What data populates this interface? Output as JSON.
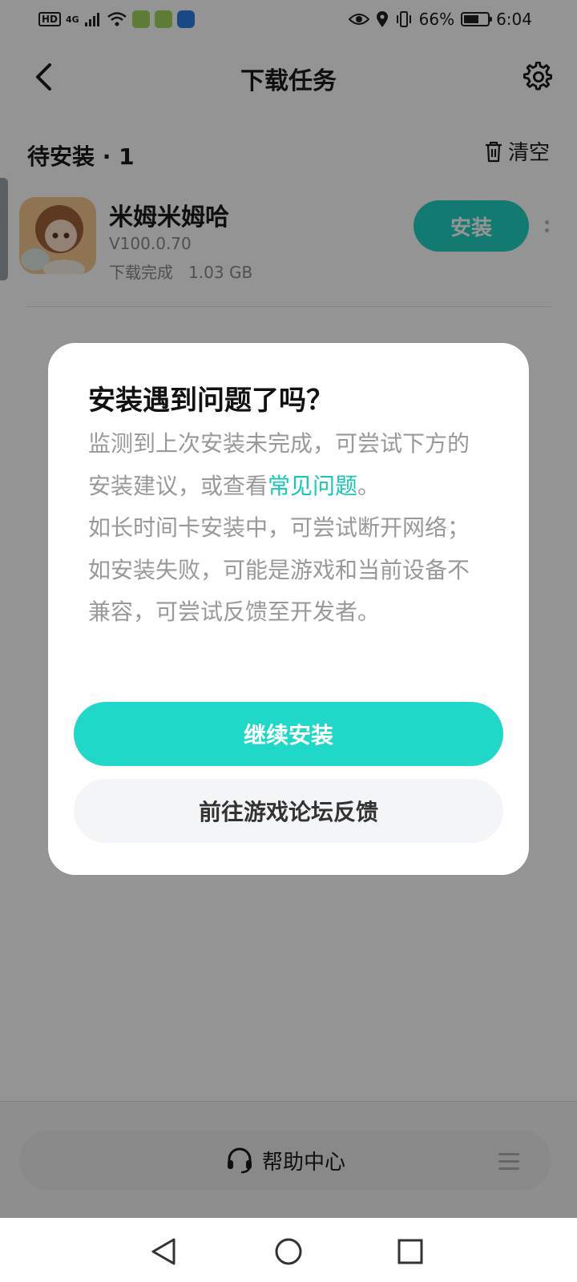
{
  "status_bar": {
    "hd": "HD",
    "network": "4G",
    "battery": "66%",
    "battery_level": 0.66,
    "time": "6:04"
  },
  "header": {
    "title": "下载任务",
    "back_icon": "chevron-left-icon",
    "settings_icon": "gear-icon"
  },
  "section": {
    "title": "待安装 · 1",
    "clear_label": "清空",
    "clear_icon": "trash-icon"
  },
  "app": {
    "name": "米姆米姆哈",
    "version": "V100.0.70",
    "status": "下载完成   1.03 GB",
    "install_label": "安装"
  },
  "bottom": {
    "help_label": "帮助中心",
    "help_icon": "headset-icon"
  },
  "dialog": {
    "title": "安装遇到问题了吗？",
    "body_line1_pre": "监测到上次安装未完成，可尝试下方的安装建议，或查看",
    "body_link": "常见问题",
    "body_line1_post": "。",
    "body_line2": "如长时间卡安装中，可尝试断开网络；",
    "body_line3": "如安装失败，可能是游戏和当前设备不兼容，可尝试反馈至开发者。",
    "primary_label": "继续安装",
    "secondary_label": "前往游戏论坛反馈"
  },
  "colors": {
    "accent": "#1fd8c8",
    "link": "#17c7b8"
  }
}
